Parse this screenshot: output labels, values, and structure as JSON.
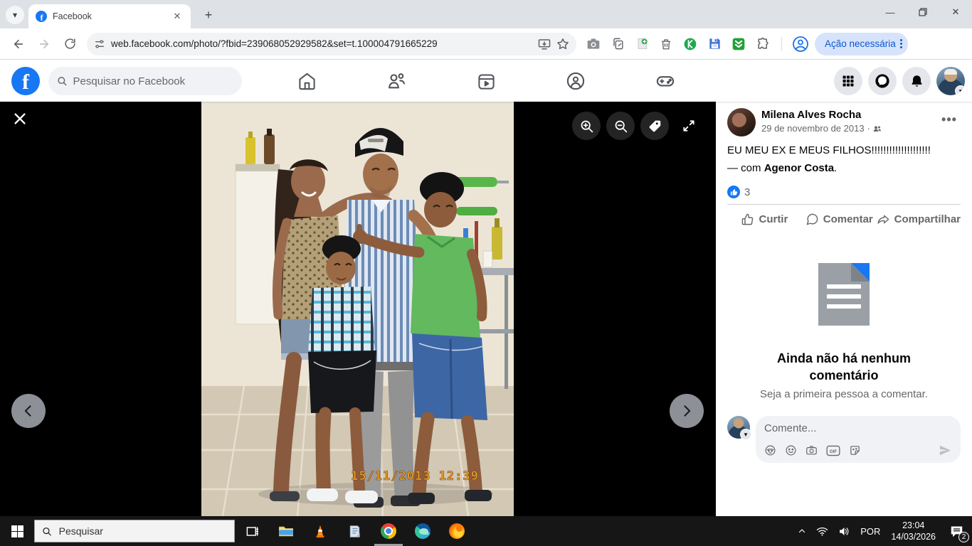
{
  "browser": {
    "tab_title": "Facebook",
    "url": "web.facebook.com/photo/?fbid=239068052929582&set=t.100004791665229",
    "action_pill": "Ação necessária",
    "extension_icons": [
      "install-app",
      "bookmark-star",
      "screenshot-camera",
      "copy-pages",
      "add-note",
      "trash",
      "kaspersky",
      "save-disk",
      "updates",
      "puzzle-extensions",
      "profile"
    ]
  },
  "facebook": {
    "search_placeholder": "Pesquisar no Facebook",
    "nav_icons": [
      "home",
      "friends",
      "watch",
      "groups",
      "gaming"
    ],
    "header_icons": [
      "apps-grid",
      "messenger",
      "notifications",
      "profile-avatar"
    ]
  },
  "viewer": {
    "controls": [
      "close",
      "zoom-in",
      "zoom-out",
      "tag",
      "fullscreen",
      "previous",
      "next"
    ],
    "photo_timestamp": "15/11/2013 12:39"
  },
  "post": {
    "author": "Milena Alves Rocha",
    "date": "29 de novembro de 2013",
    "date_sep": "·",
    "body": "EU MEU EX E MEUS FILHOS!!!!!!!!!!!!!!!!!!!!",
    "with_prefix": "— com ",
    "tagged_name": "Agenor Costa",
    "with_suffix": ".",
    "like_count": "3",
    "like_label": "Curtir",
    "comment_label": "Comentar",
    "share_label": "Compartilhar"
  },
  "comments": {
    "empty_title": "Ainda não há nenhum comentário",
    "empty_subtitle": "Seja a primeira pessoa a comentar.",
    "composer_placeholder": "Comente...",
    "composer_icons": [
      "avatar-emoji",
      "smiley",
      "camera",
      "gif",
      "sticker",
      "send"
    ],
    "gif_label": "GIF"
  },
  "taskbar": {
    "search_placeholder": "Pesquisar",
    "app_icons": [
      "start",
      "task-view",
      "file-explorer",
      "vlc",
      "notepad",
      "chrome",
      "edge",
      "firefox"
    ],
    "language": "POR",
    "time": "23:04",
    "date": "14/03/2026",
    "notification_count": "2"
  },
  "colors": {
    "facebook_blue": "#1877f2",
    "viewer_bg": "#000000",
    "action_pill_bg": "#d7e3fb",
    "action_pill_text": "#0b57d0",
    "timestamp_orange": "#e8a52c"
  }
}
